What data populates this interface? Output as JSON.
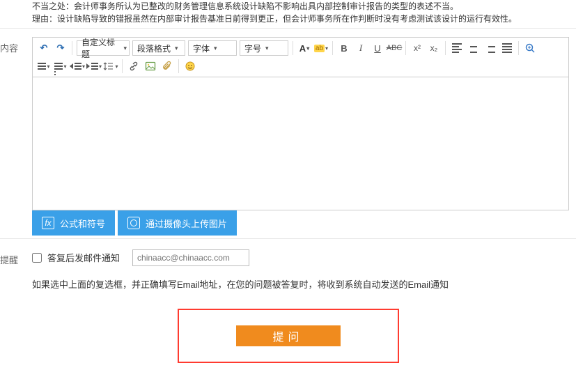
{
  "top_text": {
    "line1": "不当之处：会计师事务所认为已整改的财务管理信息系统设计缺陷不影响出具内部控制审计报告的类型的表述不当。",
    "line2": "理由：设计缺陷导致的错报虽然在内部审计报告基准日前得到更正，但会计师事务所在作判断时没有考虑测试该设计的运行有效性。"
  },
  "labels": {
    "content": "内容",
    "remind": "提醒"
  },
  "toolbar": {
    "custom_title": "自定义标题",
    "para_format": "段落格式",
    "font_family": "字体",
    "font_size": "字号"
  },
  "bluebar": {
    "formula": "公式和符号",
    "camera": "通过摄像头上传图片"
  },
  "remind": {
    "checkbox_label": "答复后发邮件通知",
    "email_placeholder": "chinaacc@chinaacc.com"
  },
  "hint": "如果选中上面的复选框，并正确填写Email地址，在您的问题被答复时，将收到系统自动发送的Email通知",
  "submit": {
    "label": "提问"
  }
}
